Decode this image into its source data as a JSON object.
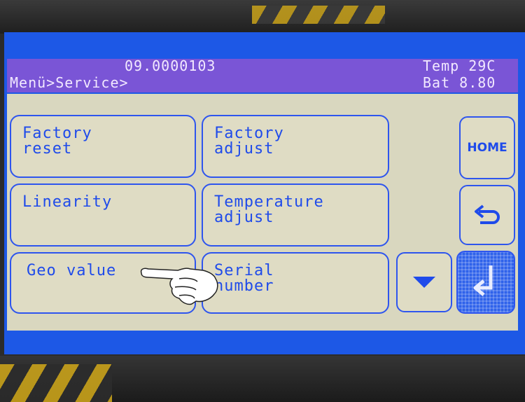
{
  "status": {
    "device_id": "09.0000103",
    "breadcrumb": "Menü>Service>",
    "temperature": "Temp 29C",
    "battery": "Bat 8.80"
  },
  "menu": {
    "items": [
      {
        "line1": "Factory",
        "line2": "reset"
      },
      {
        "line1": "Factory",
        "line2": "adjust"
      },
      {
        "line1": "Linearity",
        "line2": ""
      },
      {
        "line1": "Temperature",
        "line2": "adjust"
      },
      {
        "line1": "Geo value",
        "line2": ""
      },
      {
        "line1": "Serial",
        "line2": "number"
      }
    ]
  },
  "side_buttons": {
    "home_label": "HOME",
    "back_icon": "return-arrow-icon",
    "scroll_icon": "chevron-down-icon",
    "enter_icon": "enter-arrow-icon"
  },
  "colors": {
    "screen_blue": "#1e5ae8",
    "button_text": "#1f4bea",
    "header_purple": "#7a55d6",
    "button_bg": "#dfdcc4"
  }
}
